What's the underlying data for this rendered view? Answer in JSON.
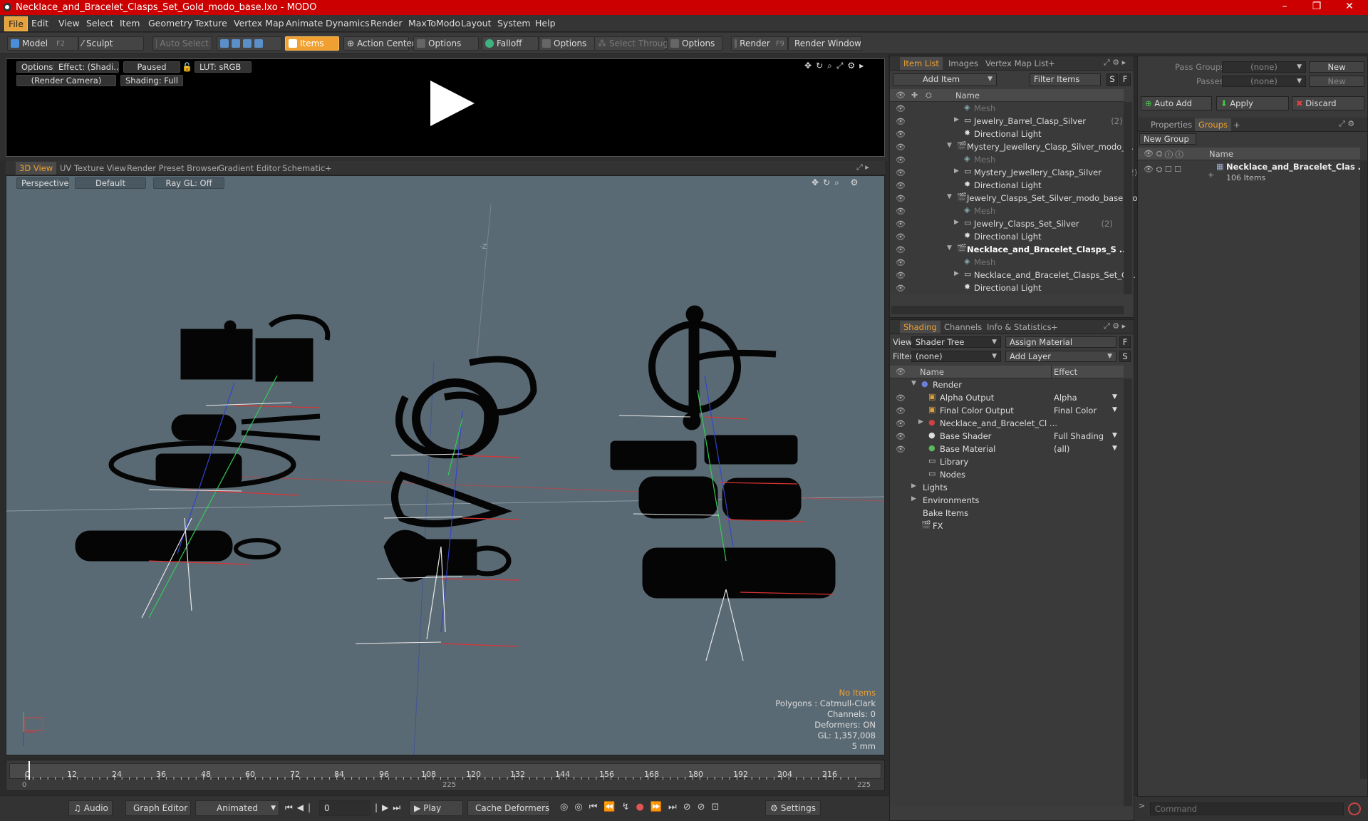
{
  "window": {
    "title": "Necklace_and_Bracelet_Clasps_Set_Gold_modo_base.lxo - MODO",
    "min": "–",
    "max": "❐",
    "close": "✕"
  },
  "menu": [
    "File",
    "Edit",
    "View",
    "Select",
    "Item",
    "Geometry",
    "Texture",
    "Vertex Map",
    "Animate",
    "Dynamics",
    "Render",
    "MaxToModo",
    "Layout",
    "System",
    "Help"
  ],
  "toolbar": {
    "model": "Model",
    "model_key": "F2",
    "sculpt": "Sculpt",
    "auto_select": "Auto Select",
    "items": "Items",
    "action_center": "Action Center",
    "options1": "Options",
    "falloff": "Falloff",
    "options2": "Options",
    "select_through": "Select Through",
    "options3": "Options",
    "render": "Render",
    "render_key": "F9",
    "render_window": "Render Window"
  },
  "preview": {
    "options": "Options",
    "effect": "Effect: (Shadi...",
    "paused": "Paused",
    "lut": "LUT: sRGB",
    "camera": "(Render Camera)",
    "shading": "Shading: Full"
  },
  "viewport_tabs": [
    "3D View",
    "UV Texture View",
    "Render Preset Browser",
    "Gradient Editor",
    "Schematic",
    "+"
  ],
  "viewport": {
    "perspective": "Perspective",
    "default": "Default",
    "raygl": "Ray GL: Off",
    "axis_label": "-Z",
    "stats": {
      "no_items": "No Items",
      "polygons": "Polygons : Catmull-Clark",
      "channels": "Channels: 0",
      "deformers": "Deformers: ON",
      "gl": "GL: 1,357,008",
      "scale": "5 mm"
    }
  },
  "timeline": {
    "ticks": [
      "0",
      "12",
      "24",
      "36",
      "48",
      "60",
      "72",
      "84",
      "96",
      "108",
      "120",
      "132",
      "144",
      "156",
      "168",
      "180",
      "192",
      "204",
      "216"
    ],
    "start": "0",
    "mid": "225",
    "end": "225"
  },
  "bottom": {
    "audio": "Audio",
    "graph_editor": "Graph Editor",
    "animated": "Animated",
    "frame": "0",
    "play": "Play",
    "cache_deformers": "Cache Deformers",
    "settings": "Settings"
  },
  "item_list": {
    "tabs": [
      "Item List",
      "Images",
      "Vertex Map List",
      "+"
    ],
    "add_item": "Add Item",
    "filter_items": "Filter Items",
    "s": "S",
    "f": "F",
    "name_col": "Name",
    "rows": [
      {
        "indent": 2,
        "label": "Mesh",
        "kind": "mesh",
        "count": ""
      },
      {
        "indent": 2,
        "label": "Jewelry_Barrel_Clasp_Silver",
        "kind": "group",
        "count": "(2)"
      },
      {
        "indent": 2,
        "label": "Directional Light",
        "kind": "light",
        "count": ""
      },
      {
        "indent": 1,
        "label": "Mystery_Jewellery_Clasp_Silver_modo_...",
        "kind": "scene",
        "count": ""
      },
      {
        "indent": 2,
        "label": "Mesh",
        "kind": "mesh",
        "count": ""
      },
      {
        "indent": 2,
        "label": "Mystery_Jewellery_Clasp_Silver",
        "kind": "group",
        "count": "(2)"
      },
      {
        "indent": 2,
        "label": "Directional Light",
        "kind": "light",
        "count": ""
      },
      {
        "indent": 1,
        "label": "Jewelry_Clasps_Set_Silver_modo_base.lxo",
        "kind": "scene",
        "count": ""
      },
      {
        "indent": 2,
        "label": "Mesh",
        "kind": "mesh",
        "count": ""
      },
      {
        "indent": 2,
        "label": "Jewelry_Clasps_Set_Silver",
        "kind": "group",
        "count": "(2)"
      },
      {
        "indent": 2,
        "label": "Directional Light",
        "kind": "light",
        "count": ""
      },
      {
        "indent": 1,
        "label": "Necklace_and_Bracelet_Clasps_S ...",
        "kind": "scene-bold",
        "count": ""
      },
      {
        "indent": 2,
        "label": "Mesh",
        "kind": "mesh",
        "count": ""
      },
      {
        "indent": 2,
        "label": "Necklace_and_Bracelet_Clasps_Set_G...",
        "kind": "group",
        "count": ""
      },
      {
        "indent": 2,
        "label": "Directional Light",
        "kind": "light",
        "count": ""
      }
    ]
  },
  "shading": {
    "tabs": [
      "Shading",
      "Channels",
      "Info & Statistics",
      "+"
    ],
    "view_label": "View",
    "view_value": "Shader Tree",
    "assign_material": "Assign Material",
    "filter_label": "Filter",
    "filter_value": "(none)",
    "add_layer": "Add Layer",
    "f": "F",
    "s": "S",
    "name_col": "Name",
    "effect_col": "Effect",
    "rows": [
      {
        "label": "Render",
        "effect": "",
        "indent": 0
      },
      {
        "label": "Alpha Output",
        "effect": "Alpha",
        "indent": 1
      },
      {
        "label": "Final Color Output",
        "effect": "Final Color",
        "indent": 1
      },
      {
        "label": "Necklace_and_Bracelet_Cl ...",
        "effect": "",
        "indent": 1
      },
      {
        "label": "Base Shader",
        "effect": "Full Shading",
        "indent": 1
      },
      {
        "label": "Base Material",
        "effect": "(all)",
        "indent": 1
      },
      {
        "label": "Library",
        "effect": "",
        "indent": 1
      },
      {
        "label": "Nodes",
        "effect": "",
        "indent": 1
      },
      {
        "label": "Lights",
        "effect": "",
        "indent": 0
      },
      {
        "label": "Environments",
        "effect": "",
        "indent": 0
      },
      {
        "label": "Bake Items",
        "effect": "",
        "indent": 0
      },
      {
        "label": "FX",
        "effect": "",
        "indent": 0
      }
    ]
  },
  "right": {
    "pass_groups": "Pass Groups",
    "pass_value": "(none)",
    "new": "New",
    "passes": "Passes",
    "passes_value": "(none)",
    "new2": "New",
    "auto_add": "Auto Add",
    "apply": "Apply",
    "discard": "Discard",
    "tabs": [
      "Properties",
      "Groups",
      "+"
    ],
    "new_group": "New Group",
    "name_col": "Name",
    "group_name": "Necklace_and_Bracelet_Clas ...",
    "group_count": "106 Items",
    "command_placeholder": "Command"
  }
}
